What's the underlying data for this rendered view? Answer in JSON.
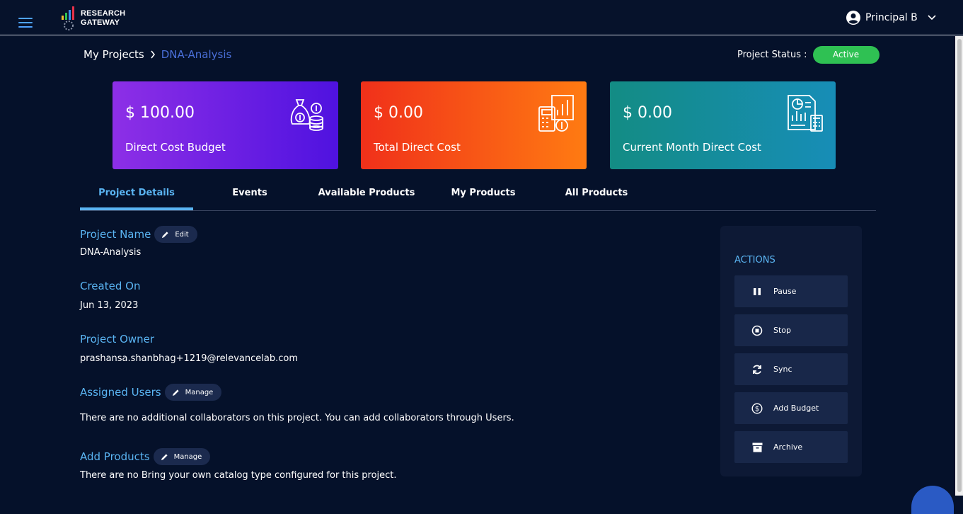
{
  "header": {
    "logo_line1": "RESEARCH",
    "logo_line2": "GATEWAY",
    "user_name": "Principal B"
  },
  "breadcrumb": {
    "root": "My Projects",
    "current": "DNA-Analysis"
  },
  "project_status": {
    "label": "Project Status :",
    "value": "Active",
    "color": "#2fc153"
  },
  "cards": [
    {
      "amount": "$ 100.00",
      "label": "Direct Cost Budget",
      "icon": "money-bag-icon"
    },
    {
      "amount": "$ 0.00",
      "label": "Total Direct Cost",
      "icon": "calculator-chart-icon"
    },
    {
      "amount": "$ 0.00",
      "label": "Current Month Direct Cost",
      "icon": "report-chart-icon"
    }
  ],
  "tabs": [
    {
      "label": "Project Details",
      "active": true
    },
    {
      "label": "Events"
    },
    {
      "label": "Available Products"
    },
    {
      "label": "My Products"
    },
    {
      "label": "All Products"
    }
  ],
  "details": {
    "project_name_label": "Project Name",
    "edit_label": "Edit",
    "project_name": "DNA-Analysis",
    "created_on_label": "Created On",
    "created_on": "Jun 13, 2023",
    "owner_label": "Project Owner",
    "owner": "prashansa.shanbhag+1219@relevancelab.com",
    "assigned_users_label": "Assigned Users",
    "manage_label": "Manage",
    "assigned_users_text": "There are no additional collaborators on this project. You can add collaborators through Users.",
    "add_products_label": "Add Products",
    "add_products_text": "There are no Bring your own catalog type configured for this project."
  },
  "actions": {
    "title": "ACTIONS",
    "buttons": [
      {
        "label": "Pause",
        "icon": "pause-icon"
      },
      {
        "label": "Stop",
        "icon": "stop-icon"
      },
      {
        "label": "Sync",
        "icon": "sync-icon"
      },
      {
        "label": "Add Budget",
        "icon": "dollar-circle-icon"
      },
      {
        "label": "Archive",
        "icon": "archive-icon"
      }
    ]
  },
  "colors": {
    "accent": "#5ab4f2",
    "background": "#05112a"
  }
}
